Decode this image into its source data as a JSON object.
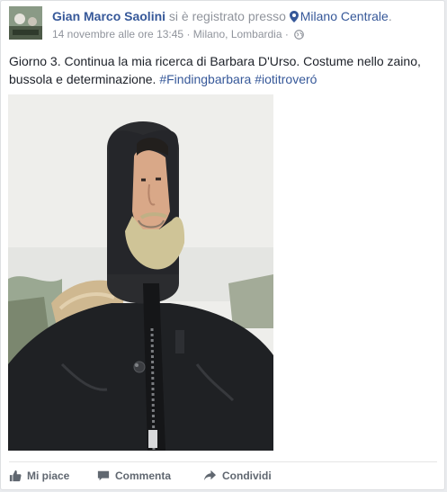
{
  "post": {
    "author": "Gian Marco Saolini",
    "verb": "si è registrato presso",
    "place": "Milano Centrale",
    "place_suffix": ".",
    "timestamp": "14 novembre alle ore 13:45",
    "separator": "·",
    "location": "Milano, Lombardia",
    "body_text": "Giorno 3. Continua la mia ricerca di Barbara D'Urso. Costume nello zaino, bussola e determinazione.",
    "hashtags": [
      "#Findingbarbara",
      "#iotitroveró"
    ]
  },
  "actions": {
    "like": "Mi piace",
    "comment": "Commenta",
    "share": "Condividi"
  },
  "icons": {
    "pin": "location-pin-icon",
    "globe": "globe-icon",
    "like": "thumbs-up-icon",
    "comment": "comment-icon",
    "share": "share-arrow-icon"
  },
  "colors": {
    "link": "#365899",
    "meta": "#90949c",
    "text": "#1d2129",
    "action": "#606770"
  }
}
